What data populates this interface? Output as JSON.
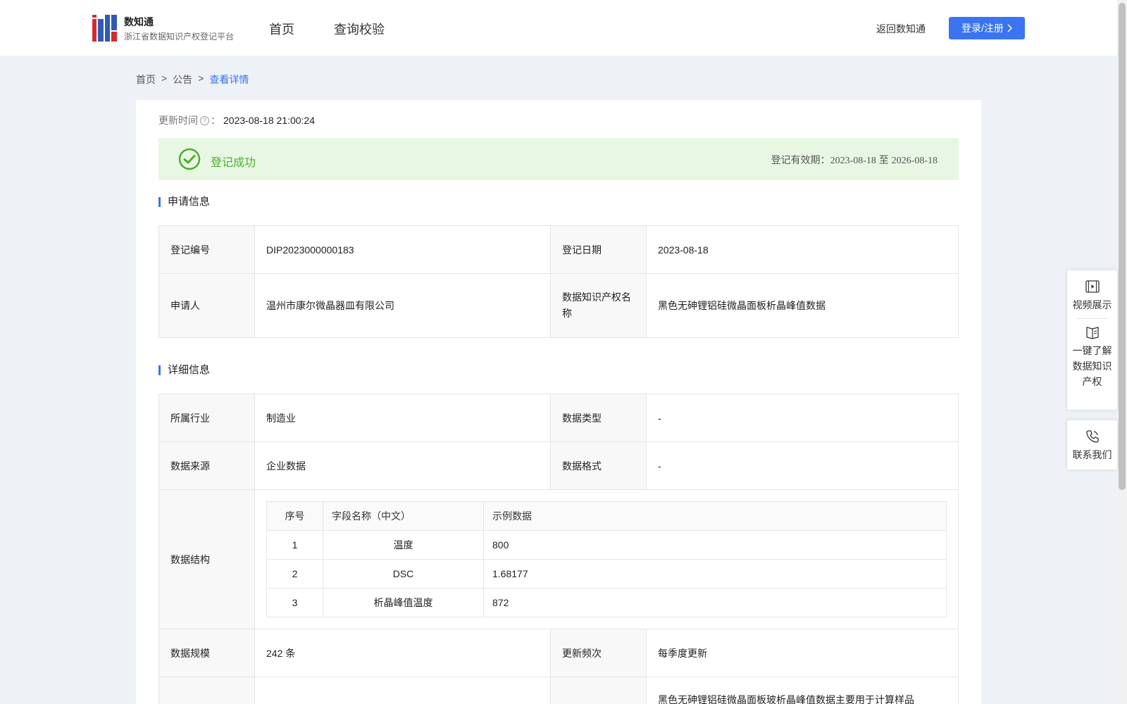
{
  "header": {
    "logo_title": "数知通",
    "logo_subtitle": "浙江省数据知识产权登记平台",
    "nav": [
      "首页",
      "查询校验"
    ],
    "return_link": "返回数知通",
    "login_button": "登录/注册"
  },
  "breadcrumb": [
    "首页",
    "公告",
    "查看详情"
  ],
  "update": {
    "label": "更新时间",
    "separator": "：",
    "value": "2023-08-18 21:00:24"
  },
  "status": {
    "text": "登记成功",
    "validity_label": "登记有效期：",
    "validity_start": "2023-08-18",
    "validity_to": "至",
    "validity_end": "2026-08-18",
    "color": "#4cae2e"
  },
  "sections": {
    "application": "申请信息",
    "details": "详细信息"
  },
  "application_info": {
    "reg_no_label": "登记编号",
    "reg_no": "DIP2023000000183",
    "reg_date_label": "登记日期",
    "reg_date": "2023-08-18",
    "applicant_label": "申请人",
    "applicant": "温州市康尔微晶器皿有限公司",
    "ip_name_label": "数据知识产权名称",
    "ip_name": "黑色无砷锂铝硅微晶面板析晶峰值数据"
  },
  "detail_info": {
    "industry_label": "所属行业",
    "industry": "制造业",
    "data_type_label": "数据类型",
    "data_type": "-",
    "source_label": "数据来源",
    "source": "企业数据",
    "format_label": "数据格式",
    "format": "-",
    "structure_label": "数据结构",
    "structure_headers": [
      "序号",
      "字段名称（中文）",
      "示例数据"
    ],
    "structure_rows": [
      [
        "1",
        "温度",
        "800"
      ],
      [
        "2",
        "DSC",
        "1.68177"
      ],
      [
        "3",
        "析晶峰值温度",
        "872"
      ]
    ],
    "scale_label": "数据规模",
    "scale": "242 条",
    "frequency_label": "更新频次",
    "frequency": "每季度更新",
    "description_partial": "黑色无砷锂铝硅微晶面板玻析晶峰值数据主要用于计算样品"
  },
  "side_panel": {
    "video": "视频展示",
    "learn": "一键了解数据知识产权",
    "contact": "联系我们"
  },
  "colors": {
    "accent": "#3a74f0",
    "success_bg": "#e8f7e4",
    "page_bg": "#eef2f6"
  }
}
